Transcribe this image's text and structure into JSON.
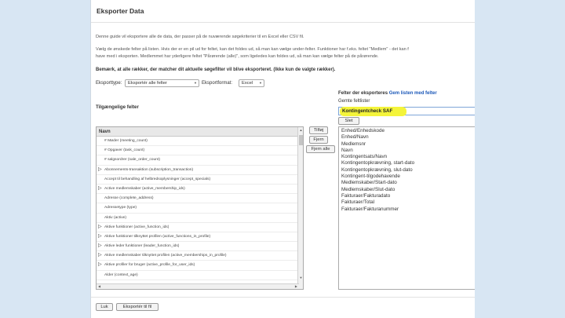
{
  "dialog": {
    "title": "Eksporter Data",
    "intro": "Denne guide vil eksportere alle de data, der passer på de nuværende søgekriterier til en Excel eller CSV fil.",
    "instructions_line1": "Vælg de ønskede felter på listen. Hvis der er en pil ud for feltet, kan det foldes ud, så man kan vælge under-felter. Funktioner har f.eks. feltet \"Medlem\" - det kan f",
    "instructions_line2": "have med i eksporten. Medlemmet har yderligere feltet \"Pårørende (alle)\", som ligeledes kan foldes ud, så man kan vælge felter på de pårørende.",
    "note": "Bemærk, at alle rækker, der matcher dit aktuelle søgefilter vil blive eksporteret. (Ikke kun de valgte rækker)."
  },
  "options": {
    "export_type_label": "Eksporttype:",
    "export_type_value": "Eksportér alle felter",
    "export_format_label": "Eksportformat:",
    "export_format_value": "Excel"
  },
  "available": {
    "heading": "Tilgængelige felter",
    "column_header": "Navn",
    "rows": [
      {
        "label": "# Møder (meeting_count)",
        "expandable": false
      },
      {
        "label": "# Opgaver (task_count)",
        "expandable": false
      },
      {
        "label": "# salgsordrer (sale_order_count)",
        "expandable": false
      },
      {
        "label": "Abonnements-transaktion (subscription_transaction)",
        "expandable": true
      },
      {
        "label": "Accept til behandling af helbredsoplysninger (accept_specials)",
        "expandable": false
      },
      {
        "label": "Active medlemskaber (active_membership_ids)",
        "expandable": true
      },
      {
        "label": "Adresse (complete_address)",
        "expandable": false
      },
      {
        "label": "Adressetype (type)",
        "expandable": false
      },
      {
        "label": "Aktiv (active)",
        "expandable": false
      },
      {
        "label": "Aktive funktioner (active_function_ids)",
        "expandable": true
      },
      {
        "label": "Aktive funktioner tilknyttet profilen (active_functions_in_profile)",
        "expandable": true
      },
      {
        "label": "Aktive leder funktioner (leader_function_ids)",
        "expandable": true
      },
      {
        "label": "Aktive medlemskaber tilknyttet profilen (active_memberships_in_profile)",
        "expandable": true
      },
      {
        "label": "Aktive profiler for bruger (active_profile_for_user_ids)",
        "expandable": true
      },
      {
        "label": "Alder (context_age)",
        "expandable": false
      }
    ]
  },
  "transfer": {
    "add": "Tilføj",
    "remove": "Fjern",
    "remove_all": "Fjern alle"
  },
  "export_panel": {
    "heading_prefix": "Felter der eksporteres",
    "save_link": "Gem listen med felter",
    "saved_lists_label": "Gemte feltlister",
    "saved_list_value": "Kontingentcheck SAF",
    "delete_button": "Slet",
    "fields": [
      "Enhed/Enhedskode",
      "Enhed/Navn",
      "Medlemsnr",
      "Navn",
      "Kontingentsats/Navn",
      "Kontingentopkrævning, start-dato",
      "Kontingentopkrævning, slut-dato",
      "Kontingent-tilgodehavende",
      "Medlemskaber/Start-dato",
      "Medlemskaber/Slut-dato",
      "Fakturaer/Fakturadato",
      "Fakturaer/Total",
      "Fakturaer/Fakturanummer"
    ]
  },
  "footer": {
    "close": "Luk",
    "export": "Eksportér til fil"
  },
  "colors": {
    "background": "#d8e6f3",
    "highlight": "#f4f43a",
    "link": "#1a57b8"
  }
}
